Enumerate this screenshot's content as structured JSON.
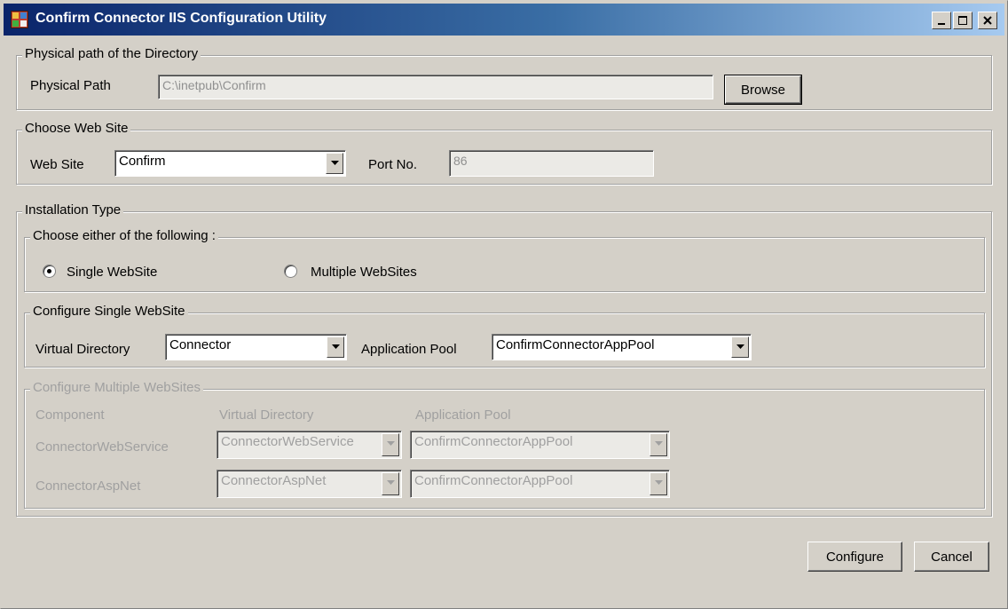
{
  "window": {
    "title": "Confirm Connector IIS Configuration Utility"
  },
  "physical_path": {
    "group_label": "Physical path of the Directory",
    "label": "Physical Path",
    "value": "C:\\inetpub\\Confirm",
    "browse_label": "Browse"
  },
  "web_site": {
    "group_label": "Choose Web Site",
    "label": "Web Site",
    "selected": "Confirm",
    "port_label": "Port No.",
    "port_value": "86"
  },
  "installation": {
    "group_label": "Installation Type",
    "choose_label": "Choose either of the following :",
    "single_label": "Single WebSite",
    "multiple_label": "Multiple WebSites",
    "selected": "single"
  },
  "single": {
    "group_label": "Configure Single WebSite",
    "vdir_label": "Virtual Directory",
    "vdir_value": "Connector",
    "pool_label": "Application Pool",
    "pool_value": "ConfirmConnectorAppPool"
  },
  "multiple": {
    "group_label": "Configure Multiple WebSites",
    "headers": [
      "Component",
      "Virtual Directory",
      "Application Pool"
    ],
    "rows": [
      {
        "component": "ConnectorWebService",
        "vdir": "ConnectorWebService",
        "pool": "ConfirmConnectorAppPool"
      },
      {
        "component": "ConnectorAspNet",
        "vdir": "ConnectorAspNet",
        "pool": "ConfirmConnectorAppPool"
      }
    ]
  },
  "footer": {
    "configure_label": "Configure",
    "cancel_label": "Cancel"
  }
}
